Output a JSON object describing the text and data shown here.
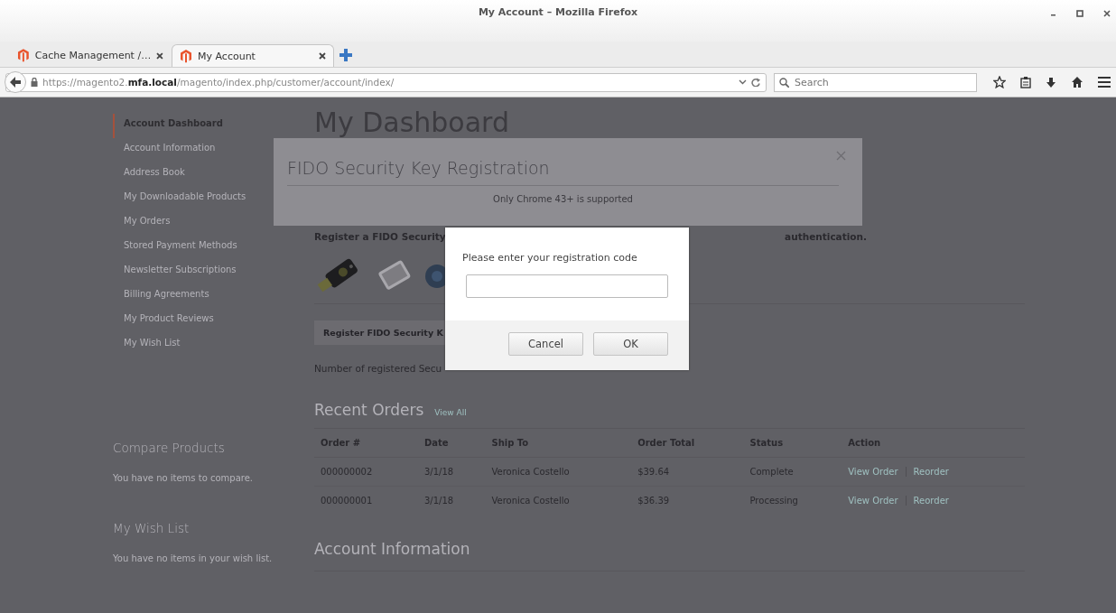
{
  "window": {
    "title": "My Account – Mozilla Firefox"
  },
  "tabs": [
    {
      "label": "Cache Management /…",
      "selected": false
    },
    {
      "label": "My Account",
      "selected": true
    }
  ],
  "address_bar": {
    "url": "https://magento2.**mfa.local**/magento/index.php/customer/account/index/"
  },
  "search": {
    "placeholder": "Search"
  },
  "sidebar": {
    "items": [
      {
        "label": "Account Dashboard",
        "selected": true
      },
      {
        "label": "Account Information",
        "selected": false
      },
      {
        "label": "Address Book",
        "selected": false
      },
      {
        "label": "My Downloadable Products",
        "selected": false
      },
      {
        "label": "My Orders",
        "selected": false
      },
      {
        "label": "Stored Payment Methods",
        "selected": false
      },
      {
        "label": "Newsletter Subscriptions",
        "selected": false
      },
      {
        "label": "Billing Agreements",
        "selected": false
      },
      {
        "label": "My Product Reviews",
        "selected": false
      },
      {
        "label": "My Wish List",
        "selected": false
      }
    ],
    "blocks": [
      {
        "title": "Compare Products",
        "text": "You have no items to compare."
      },
      {
        "title": "My Wish List",
        "text": "You have no items in your wish list."
      }
    ]
  },
  "main": {
    "title": "My Dashboard",
    "fido_heading_parts": [
      "Register a FIDO Security",
      "authentication."
    ],
    "fido_button": "Register FIDO Security K",
    "fido_count": "Number of registered Secu"
  },
  "modal": {
    "title": "FIDO Security Key Registration",
    "note": "Only Chrome 43+ is supported"
  },
  "prompt": {
    "message": "Please enter your registration code",
    "buttons": [
      "Cancel",
      "OK"
    ]
  },
  "recent_orders": {
    "title": "Recent Orders",
    "link": "View All",
    "columns": [
      "Order #",
      "Date",
      "Ship To",
      "Order Total",
      "Status",
      "Action"
    ],
    "rows": [
      {
        "cells": [
          "000000002",
          "3/1/18",
          "Veronica Costello",
          "$39.64",
          "Complete"
        ],
        "actions": [
          "View Order",
          "Reorder"
        ]
      },
      {
        "cells": [
          "000000001",
          "3/1/18",
          "Veronica Costello",
          "$36.39",
          "Processing"
        ],
        "actions": [
          "View Order",
          "Reorder"
        ]
      }
    ]
  },
  "account_information": {
    "title": "Account Information"
  }
}
